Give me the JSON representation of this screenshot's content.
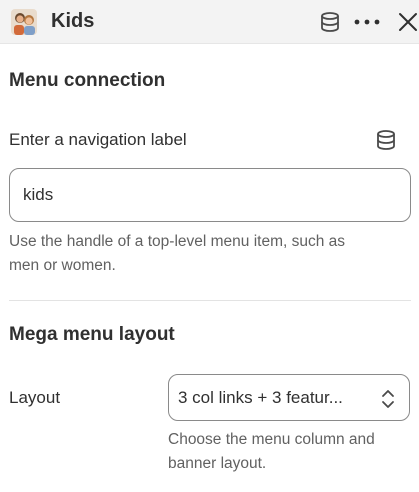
{
  "header": {
    "title": "Kids",
    "icons": [
      "thumbnail-image",
      "database-icon",
      "more-icon",
      "close-icon"
    ]
  },
  "menu_connection": {
    "heading": "Menu connection",
    "field_label": "Enter a navigation label",
    "field_value": "kids",
    "help_text_line1": "Use the handle of a top-level menu item, such as",
    "help_text_line2": "men or women."
  },
  "mega_menu": {
    "heading": "Mega menu layout",
    "layout_label": "Layout",
    "layout_value": "3 col links + 3 featur...",
    "help_text_line1": "Choose the menu column and",
    "help_text_line2": "banner layout."
  },
  "colors": {
    "header_bg": "#f3f3f3",
    "text": "#303030",
    "muted_text": "#616161",
    "border": "#8a8a8a"
  }
}
